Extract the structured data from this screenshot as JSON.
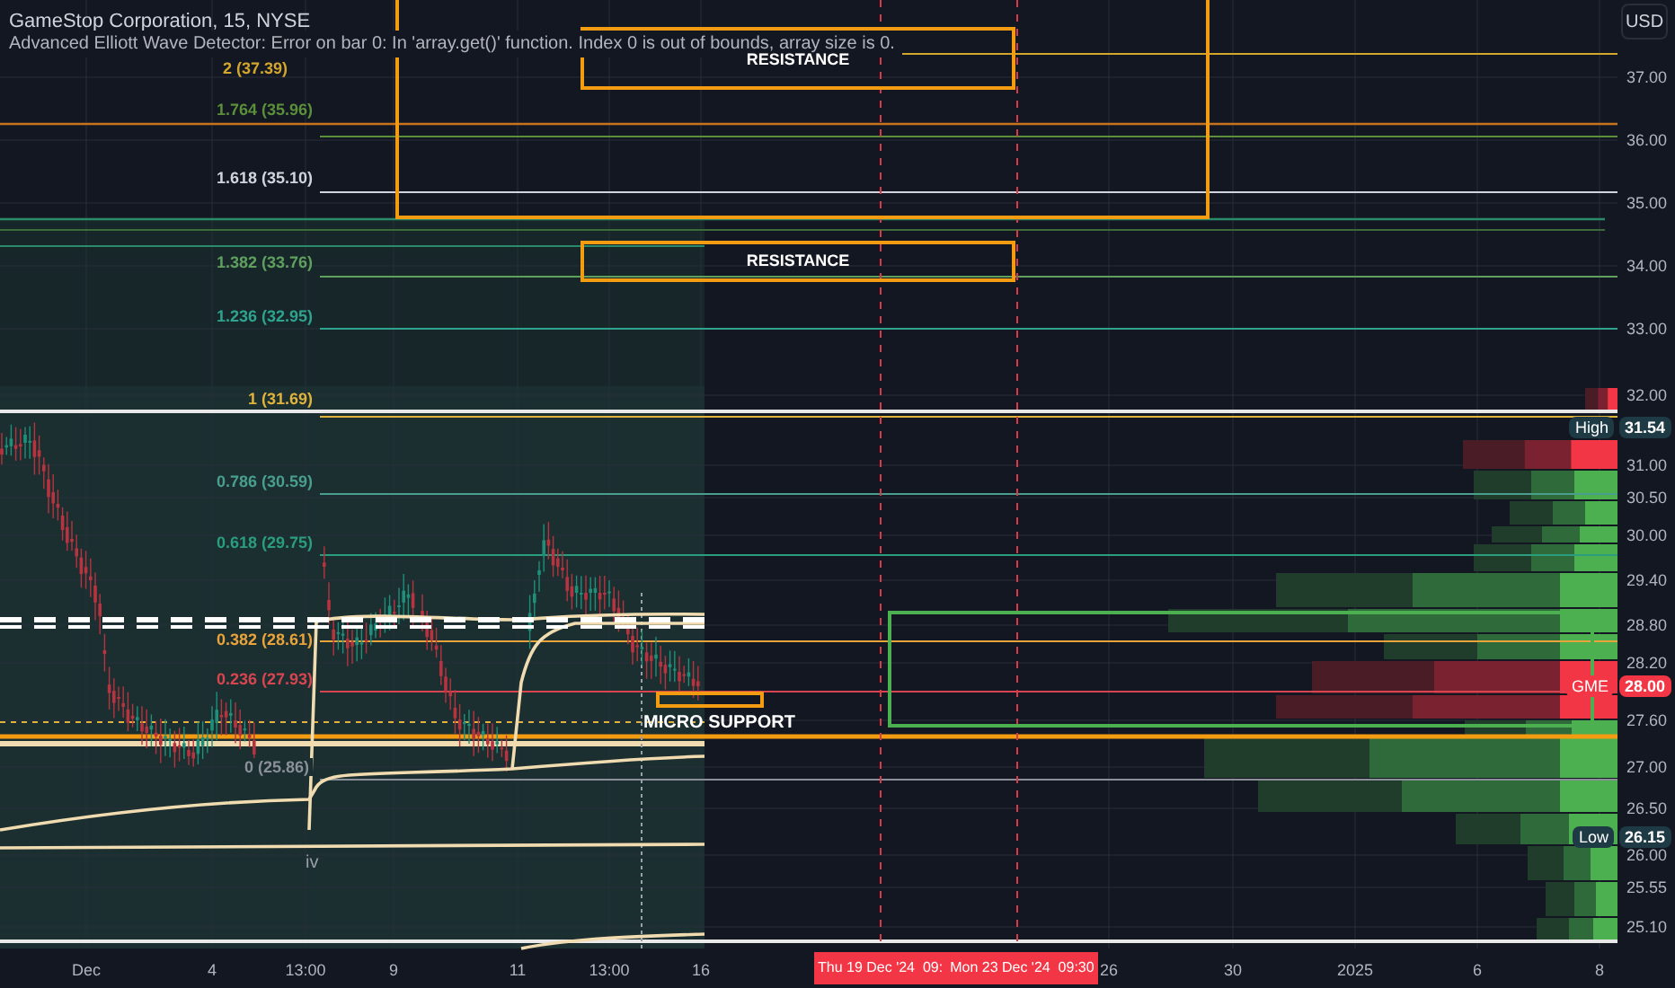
{
  "header": {
    "title": "GameStop Corporation, 15, NYSE",
    "indicator_error": "Advanced Elliott Wave Detector: Error on bar 0: In 'array.get()' function. Index 0 is out of bounds, array size is 0."
  },
  "currency_button": "USD",
  "fib_levels": [
    {
      "label": "2 (37.39)",
      "color": "#d4a72c"
    },
    {
      "label": "1.764 (35.96)",
      "color": "#5b8f3a"
    },
    {
      "label": "1.618 (35.10)",
      "color": "#d1d4dc"
    },
    {
      "label": "1.382 (33.76)",
      "color": "#5fa05f"
    },
    {
      "label": "1.236 (32.95)",
      "color": "#2fa38f"
    },
    {
      "label": "1 (31.69)",
      "color": "#e0b43c"
    },
    {
      "label": "0.786 (30.59)",
      "color": "#4a9e8e"
    },
    {
      "label": "0.618 (29.75)",
      "color": "#2a9d7f"
    },
    {
      "label": "0.382 (28.61)",
      "color": "#e8a33a"
    },
    {
      "label": "0.236 (27.93)",
      "color": "#d84550"
    },
    {
      "label": "0 (25.86)",
      "color": "#8a8f98"
    }
  ],
  "zones": [
    {
      "label": "RESISTANCE",
      "kind": "resistance"
    },
    {
      "label": "RESISTANCE",
      "kind": "resistance"
    },
    {
      "label": "MICRO SUPPORT",
      "kind": "support"
    }
  ],
  "wave_label": "iv",
  "price_axis": [
    "37.00",
    "36.00",
    "35.00",
    "34.00",
    "33.00",
    "32.00",
    "31.00",
    "30.50",
    "30.00",
    "29.40",
    "28.80",
    "28.20",
    "27.60",
    "27.00",
    "26.50",
    "26.00",
    "25.55",
    "25.10"
  ],
  "price_badges": [
    {
      "label": "High",
      "value": "31.54",
      "kind": "high"
    },
    {
      "label": "GME",
      "value": "28.00",
      "kind": "last"
    },
    {
      "label": "Low",
      "value": "26.15",
      "kind": "low"
    }
  ],
  "time_axis": [
    "Dec",
    "4",
    "13:00",
    "9",
    "11",
    "13:00",
    "16",
    "26",
    "30",
    "2025",
    "6",
    "8"
  ],
  "time_badges": [
    "Thu 19 Dec '24  09:",
    "Mon 23 Dec '24  09:30"
  ]
}
